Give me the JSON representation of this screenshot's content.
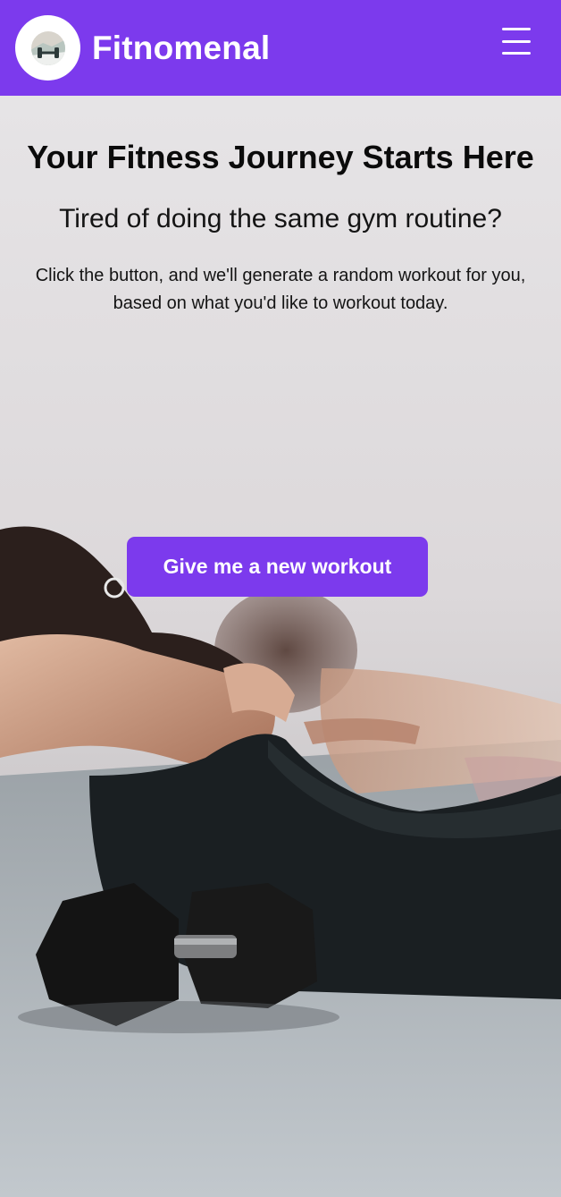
{
  "header": {
    "brand": "Fitnomenal",
    "logo_icon": "dumbbell-logo-icon",
    "menu_icon": "hamburger-menu-icon",
    "background_color": "#7c3aed"
  },
  "hero": {
    "title": "Your Fitness Journey Starts Here",
    "subtitle": "Tired of doing the same gym routine?",
    "description_line1": "Click the button, and we'll generate a random workout for you,",
    "description_line2": "based on what you'd like to workout today.",
    "cta_label": "Give me a new workout",
    "accent_color": "#7c3aed"
  }
}
